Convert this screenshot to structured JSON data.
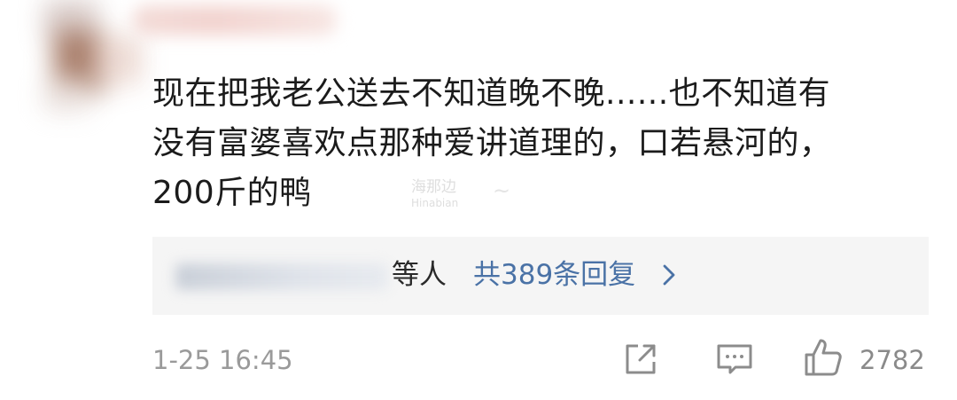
{
  "comment": {
    "line1": "现在把我老公送去不知道晚不晚......也不知道有",
    "line2": "没有富婆喜欢点那种爱讲道理的，口若悬河的，",
    "line3": "200斤的鸭"
  },
  "watermark": {
    "title": "海那边",
    "subtitle": "Hinabian"
  },
  "replies": {
    "suffix": "等人",
    "count_label": "共389条回复"
  },
  "meta": {
    "timestamp": "1-25 16:45",
    "like_count": "2782"
  },
  "icons": {
    "share": "share-icon",
    "comment": "comment-icon",
    "like": "thumbs-up-icon",
    "arrow": "chevron-right-icon"
  },
  "colors": {
    "text": "#1b1b1b",
    "link": "#4a72a6",
    "muted": "#9a9a9a",
    "reply_bg": "#f5f5f5"
  }
}
